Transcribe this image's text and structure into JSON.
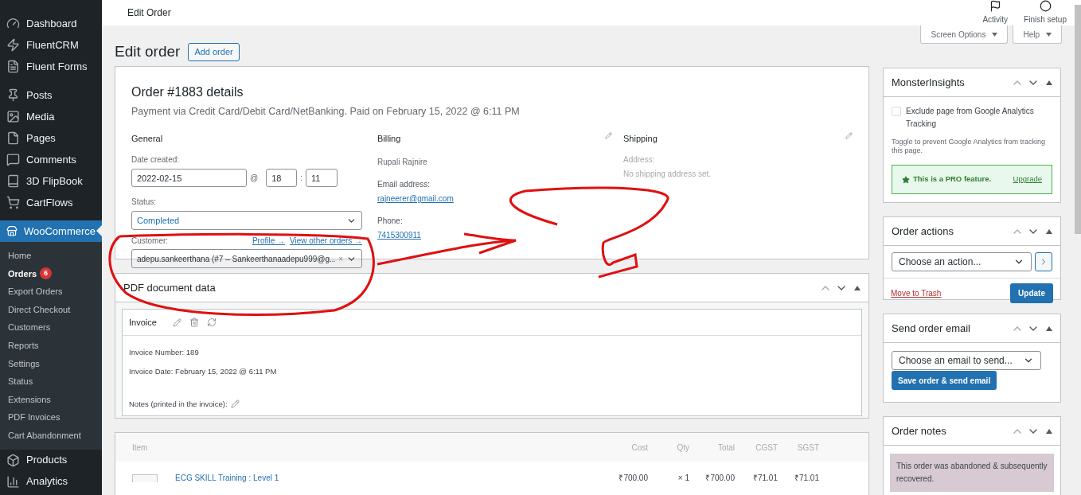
{
  "sidebar": {
    "menu_top": [
      {
        "label": "Dashboard",
        "selected": false
      },
      {
        "label": "FluentCRM",
        "selected": false
      },
      {
        "label": "Fluent Forms",
        "selected": false
      },
      {
        "label": "Posts",
        "selected": false
      },
      {
        "label": "Media",
        "selected": false
      },
      {
        "label": "Pages",
        "selected": false
      },
      {
        "label": "Comments",
        "selected": false
      },
      {
        "label": "3D FlipBook",
        "selected": false
      },
      {
        "label": "CartFlows",
        "selected": false
      },
      {
        "label": "WooCommerce",
        "selected": true
      }
    ],
    "submenu": [
      {
        "label": "Home",
        "selected": false
      },
      {
        "label": "Orders",
        "selected": true,
        "badge": "6"
      },
      {
        "label": "Export Orders",
        "selected": false
      },
      {
        "label": "Direct Checkout",
        "selected": false
      },
      {
        "label": "Customers",
        "selected": false
      },
      {
        "label": "Reports",
        "selected": false
      },
      {
        "label": "Settings",
        "selected": false
      },
      {
        "label": "Status",
        "selected": false
      },
      {
        "label": "Extensions",
        "selected": false
      },
      {
        "label": "PDF Invoices",
        "selected": false
      },
      {
        "label": "Cart Abandonment",
        "selected": false
      }
    ],
    "menu_bottom": [
      {
        "label": "Products",
        "selected": false
      },
      {
        "label": "Analytics",
        "selected": false
      }
    ]
  },
  "header": {
    "title": "Edit Order",
    "actions": [
      {
        "label": "Activity"
      },
      {
        "label": "Finish setup"
      }
    ]
  },
  "screen_tabs": [
    "Screen Options",
    "Help"
  ],
  "page": {
    "title": "Edit order",
    "add_button": "Add order"
  },
  "order": {
    "title": "Order #1883 details",
    "subtitle": "Payment via Credit Card/Debit Card/NetBanking. Paid on February 15, 2022 @ 6:11 PM",
    "general": {
      "heading": "General",
      "date_label": "Date created:",
      "date": "2022-02-15",
      "at": "@",
      "hour": "18",
      "separator": ":",
      "minute": "11",
      "status_label": "Status:",
      "status": "Completed",
      "customer_label": "Customer:",
      "links": [
        "Profile →",
        "View other orders →"
      ],
      "customer": "adepu.sankeerthana (#7 – Sankeerthanaadepu999@g...",
      "clear": "×"
    },
    "billing": {
      "heading": "Billing",
      "name": "Rupali Rajnire",
      "email_label": "Email address:",
      "email": "rajneerer@gmail.com",
      "phone_label": "Phone:",
      "phone": "7415300911"
    },
    "shipping": {
      "heading": "Shipping",
      "address_label": "Address:",
      "address": "No shipping address set."
    }
  },
  "pdf": {
    "title": "PDF document data",
    "invoice": {
      "title": "Invoice",
      "number_label": "Invoice Number:",
      "number": "189",
      "date_label": "Invoice Date:",
      "date": "February 15, 2022 @ 6:11 PM",
      "notes_label": "Notes (printed in the invoice):"
    }
  },
  "items": {
    "columns": [
      "Item",
      "Cost",
      "Qty",
      "Total",
      "CGST",
      "SGST"
    ],
    "rows": [
      {
        "name": "ECG SKILL Training : Level 1",
        "cost": "₹700.00",
        "qty": "× 1",
        "total": "₹700.00",
        "cgst": "₹71.01",
        "sgst": "₹71.01"
      }
    ]
  },
  "monster": {
    "title": "MonsterInsights",
    "checkbox": {
      "label": "Exclude page from Google Analytics Tracking",
      "checked": false
    },
    "help": "Toggle to prevent Google Analytics from tracking this page.",
    "pro": "This is a PRO feature.",
    "upgrade": "Upgrade"
  },
  "order_actions": {
    "title": "Order actions",
    "select": "Choose an action...",
    "trash": "Move to Trash",
    "update": "Update"
  },
  "send_email": {
    "title": "Send order email",
    "select": "Choose an email to send...",
    "button": "Save order & send email"
  },
  "order_notes": {
    "title": "Order notes",
    "notes": [
      {
        "text": "This order was abandoned & subsequently recovered."
      }
    ]
  }
}
